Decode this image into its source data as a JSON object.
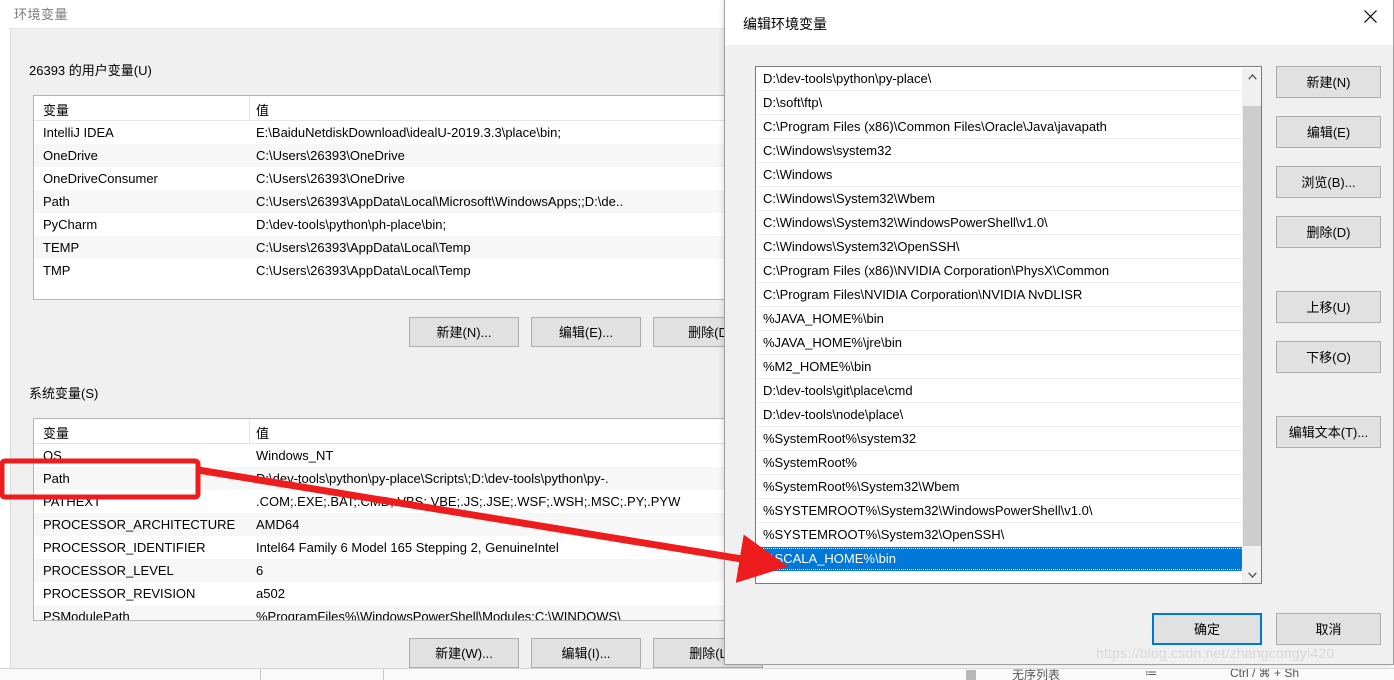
{
  "env_window": {
    "title": "环境变量",
    "user_section": {
      "label": "26393 的用户变量(U)",
      "columns": [
        "变量",
        "值"
      ],
      "rows": [
        {
          "name": "IntelliJ IDEA",
          "value": "E:\\BaiduNetdiskDownload\\idealU-2019.3.3\\place\\bin;"
        },
        {
          "name": "OneDrive",
          "value": "C:\\Users\\26393\\OneDrive"
        },
        {
          "name": "OneDriveConsumer",
          "value": "C:\\Users\\26393\\OneDrive"
        },
        {
          "name": "Path",
          "value": "C:\\Users\\26393\\AppData\\Local\\Microsoft\\WindowsApps;;D:\\de.."
        },
        {
          "name": "PyCharm",
          "value": "D:\\dev-tools\\python\\ph-place\\bin;"
        },
        {
          "name": "TEMP",
          "value": "C:\\Users\\26393\\AppData\\Local\\Temp"
        },
        {
          "name": "TMP",
          "value": "C:\\Users\\26393\\AppData\\Local\\Temp"
        }
      ],
      "buttons": [
        {
          "label": "新建(N)..."
        },
        {
          "label": "编辑(E)..."
        },
        {
          "label": "删除(D"
        }
      ]
    },
    "system_section": {
      "label": "系统变量(S)",
      "columns": [
        "变量",
        "值"
      ],
      "rows": [
        {
          "name": "OS",
          "value": "Windows_NT"
        },
        {
          "name": "Path",
          "value": "D:\\dev-tools\\python\\py-place\\Scripts\\;D:\\dev-tools\\python\\py-."
        },
        {
          "name": "PATHEXT",
          "value": ".COM;.EXE;.BAT;.CMD;.VBS;.VBE;.JS;.JSE;.WSF;.WSH;.MSC;.PY;.PYW"
        },
        {
          "name": "PROCESSOR_ARCHITECTURE",
          "value": "AMD64"
        },
        {
          "name": "PROCESSOR_IDENTIFIER",
          "value": "Intel64 Family 6 Model 165 Stepping 2, GenuineIntel"
        },
        {
          "name": "PROCESSOR_LEVEL",
          "value": "6"
        },
        {
          "name": "PROCESSOR_REVISION",
          "value": "a502"
        },
        {
          "name": "PSModulePath",
          "value": "%ProgramFiles%\\WindowsPowerShell\\Modules;C:\\WINDOWS\\"
        }
      ],
      "buttons": [
        {
          "label": "新建(W)..."
        },
        {
          "label": "编辑(I)..."
        },
        {
          "label": "删除(L"
        }
      ]
    }
  },
  "edit_dialog": {
    "title": "编辑环境变量",
    "close_label": "关闭",
    "path_entries": [
      "D:\\dev-tools\\python\\py-place\\",
      "D:\\soft\\ftp\\",
      "C:\\Program Files (x86)\\Common Files\\Oracle\\Java\\javapath",
      "C:\\Windows\\system32",
      "C:\\Windows",
      "C:\\Windows\\System32\\Wbem",
      "C:\\Windows\\System32\\WindowsPowerShell\\v1.0\\",
      "C:\\Windows\\System32\\OpenSSH\\",
      "C:\\Program Files (x86)\\NVIDIA Corporation\\PhysX\\Common",
      "C:\\Program Files\\NVIDIA Corporation\\NVIDIA NvDLISR",
      "%JAVA_HOME%\\bin",
      "%JAVA_HOME%\\jre\\bin",
      "%M2_HOME%\\bin",
      "D:\\dev-tools\\git\\place\\cmd",
      "D:\\dev-tools\\node\\place\\",
      "%SystemRoot%\\system32",
      "%SystemRoot%",
      "%SystemRoot%\\System32\\Wbem",
      "%SYSTEMROOT%\\System32\\WindowsPowerShell\\v1.0\\",
      "%SYSTEMROOT%\\System32\\OpenSSH\\",
      "%SCALA_HOME%\\bin"
    ],
    "selected_index": 20,
    "side_buttons": [
      {
        "label": "新建(N)"
      },
      {
        "label": "编辑(E)"
      },
      {
        "label": "浏览(B)..."
      },
      {
        "label": "删除(D)"
      },
      {
        "label": "上移(U)"
      },
      {
        "label": "下移(O)"
      },
      {
        "label": "编辑文本(T)..."
      }
    ],
    "ok_label": "确定",
    "cancel_label": "取消",
    "scrollbar": {
      "up_glyph": "⌃",
      "down_glyph": "⌄"
    }
  },
  "annotation": {
    "color": "#ee1c1c",
    "highlight_target": "Path",
    "arrow_target": "%SCALA_HOME%\\bin"
  },
  "watermark": {
    "text": "https://blog.csdn.net/zhangcongyi420"
  },
  "bottom_strip": {
    "label": "无序列表",
    "icon": "≔",
    "shortcut": "Ctrl / ⌘ + Sh"
  },
  "colors": {
    "accent": "#0078d7",
    "annotation_red": "#ee1c1c",
    "dialog_bg": "#f0f0f0",
    "list_bg": "#ffffff",
    "button_bg": "#e1e1e1"
  }
}
